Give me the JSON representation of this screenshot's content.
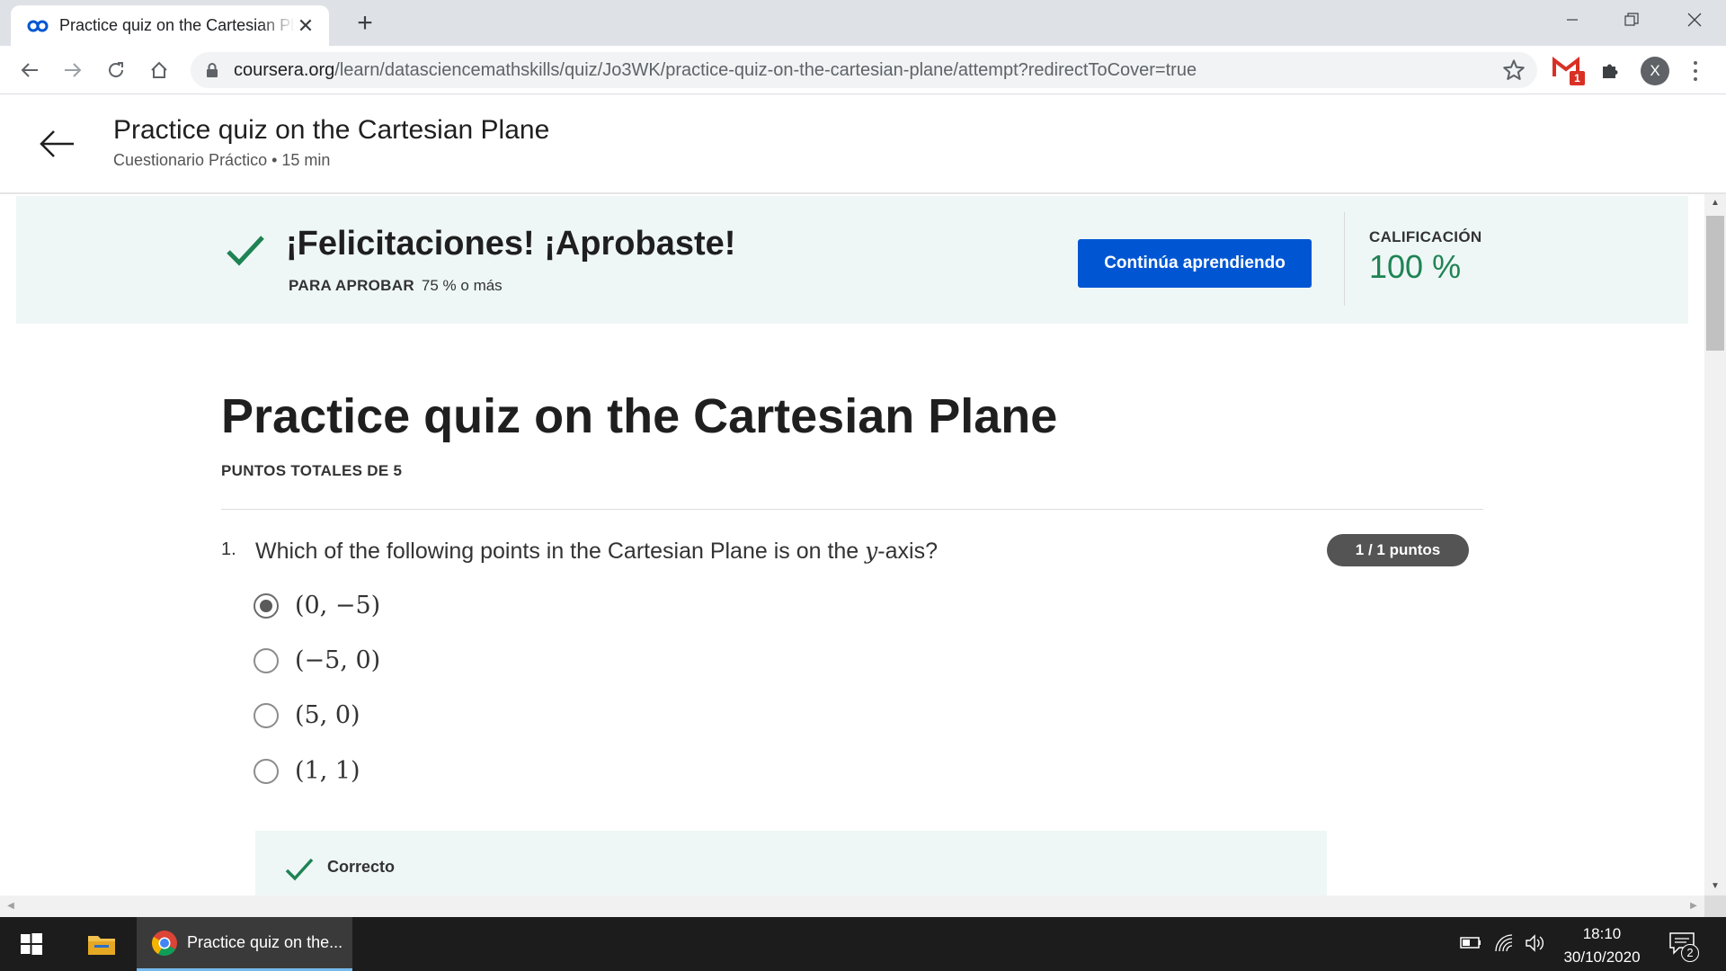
{
  "browser": {
    "tab_title": "Practice quiz on the Cartesian Plane",
    "url_host": "coursera.org",
    "url_path": "/learn/datasciencemathskills/quiz/Jo3WK/practice-quiz-on-the-cartesian-plane/attempt?redirectToCover=true",
    "profile_initial": "X",
    "gmail_badge": "1"
  },
  "header": {
    "title": "Practice quiz on the Cartesian Plane",
    "subtitle": "Cuestionario Práctico • 15 min"
  },
  "result": {
    "congrats": "¡Felicitaciones! ¡Aprobaste!",
    "pass_label": "PARA APROBAR",
    "pass_value": "75 % o más",
    "continue_label": "Continúa aprendiendo",
    "grade_label": "CALIFICACIÓN",
    "grade_value": "100 %",
    "colors": {
      "banner_bg": "#eef7f6",
      "accent_green": "#1f8354",
      "button_blue": "#0056d2"
    }
  },
  "quiz": {
    "title": "Practice quiz on the Cartesian Plane",
    "total_points": "PUNTOS TOTALES DE 5",
    "questions": [
      {
        "number": "1.",
        "text_before": "Which of the following points in the Cartesian Plane is on the ",
        "text_var": "y",
        "text_after": "-axis?",
        "points": "1 / 1 puntos",
        "options": [
          {
            "label": "(0, −5)",
            "selected": true
          },
          {
            "label": "(−5, 0)",
            "selected": false
          },
          {
            "label": "(5, 0)",
            "selected": false
          },
          {
            "label": "(1, 1)",
            "selected": false
          }
        ],
        "feedback": "Correcto"
      }
    ]
  },
  "taskbar": {
    "chrome_label": "Practice quiz on the...",
    "time": "18:10",
    "date": "30/10/2020",
    "notifications": "2"
  }
}
